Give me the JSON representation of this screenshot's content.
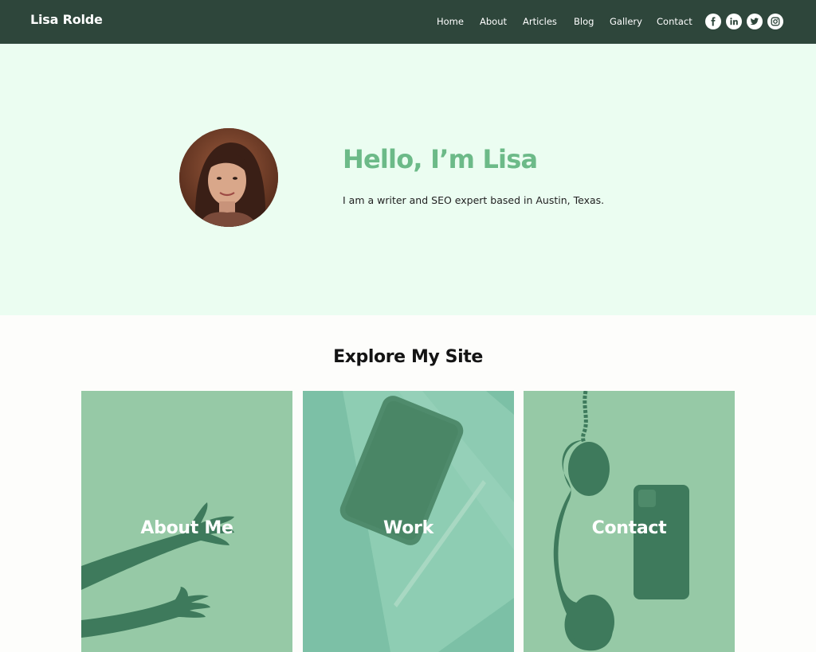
{
  "header": {
    "brand": "Lisa Rolde",
    "nav": [
      {
        "label": "Home"
      },
      {
        "label": "About"
      },
      {
        "label": "Articles"
      },
      {
        "label": "Blog"
      },
      {
        "label": "Gallery"
      },
      {
        "label": "Contact"
      }
    ],
    "social": [
      {
        "icon": "facebook-icon",
        "glyph": "f"
      },
      {
        "icon": "linkedin-icon",
        "glyph": "in"
      },
      {
        "icon": "twitter-icon",
        "glyph": ""
      },
      {
        "icon": "instagram-icon",
        "glyph": ""
      }
    ]
  },
  "hero": {
    "title": "Hello, I’m Lisa",
    "subtitle": "I am a writer and SEO expert based in Austin, Texas."
  },
  "explore": {
    "title": "Explore My Site",
    "cards": [
      {
        "label": "About Me"
      },
      {
        "label": "Work"
      },
      {
        "label": "Contact"
      }
    ]
  },
  "colors": {
    "header_bg": "#2e463b",
    "hero_bg": "#ebfdf1",
    "accent": "#6cba88",
    "card_green": "#96c9a6",
    "card_teal": "#7cc0a6",
    "card_shape": "#3e7a5c"
  }
}
